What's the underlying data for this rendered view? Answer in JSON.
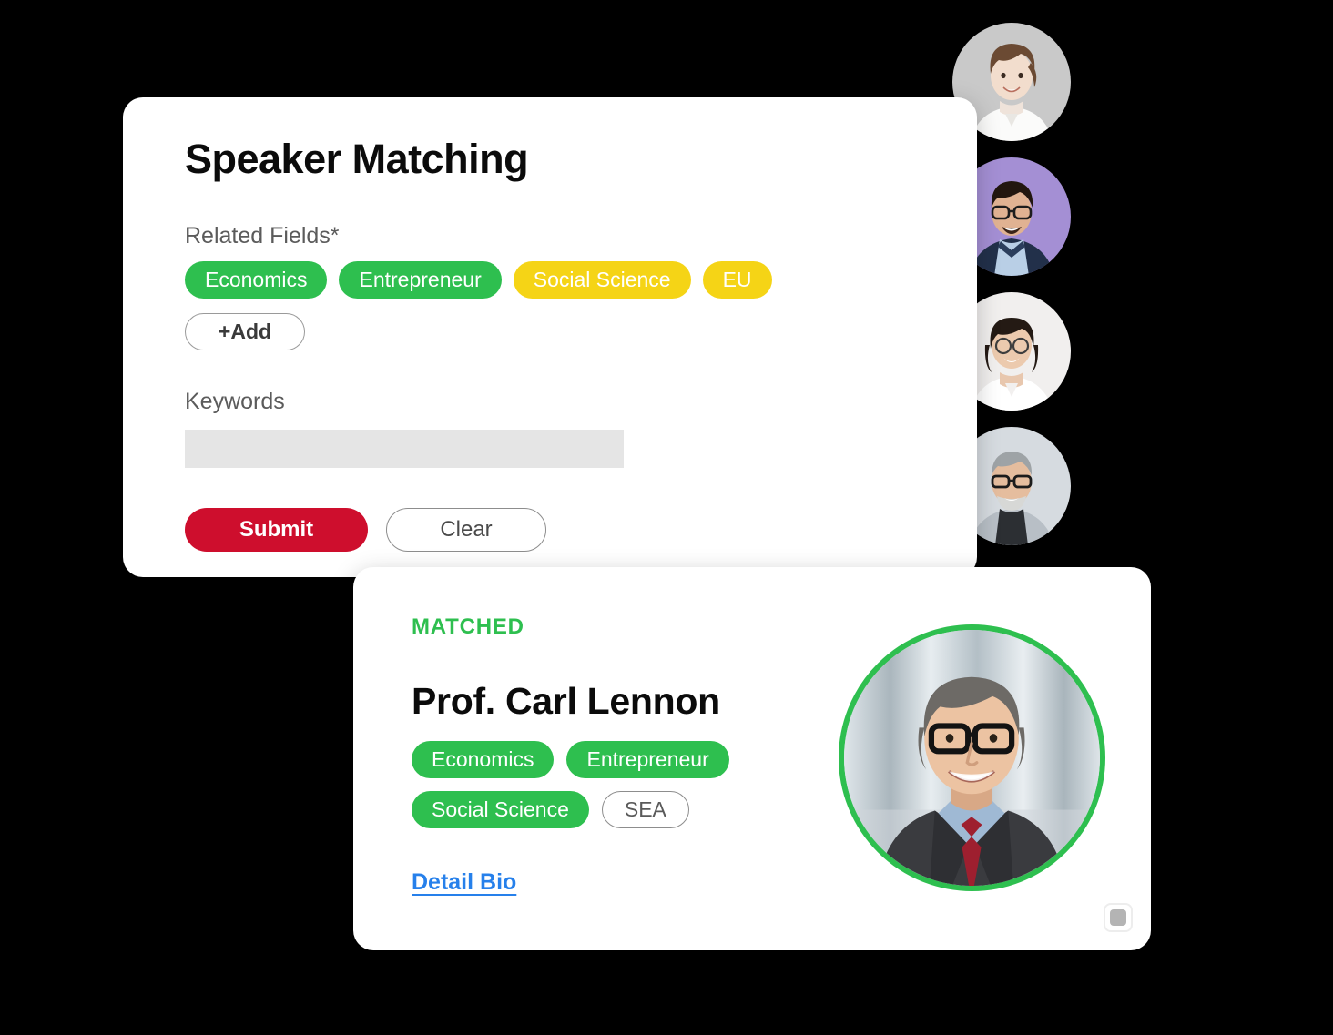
{
  "background_color": "#000000",
  "form_card": {
    "title": "Speaker Matching",
    "related_fields_label": "Related Fields*",
    "tags": [
      {
        "label": "Economics",
        "color": "#2ebf4f",
        "style": "green"
      },
      {
        "label": "Entrepreneur",
        "color": "#2ebf4f",
        "style": "green"
      },
      {
        "label": "Social Science",
        "color": "#f5d416",
        "style": "yellow"
      },
      {
        "label": "EU",
        "color": "#f5d416",
        "style": "yellow"
      }
    ],
    "add_button_label": "+Add",
    "keywords_label": "Keywords",
    "keywords_value": "",
    "keywords_placeholder": "",
    "submit_label": "Submit",
    "submit_color": "#ce0e2d",
    "clear_label": "Clear"
  },
  "matched_card": {
    "badge": "MATCHED",
    "badge_color": "#2ebf4f",
    "speaker_name": "Prof. Carl Lennon",
    "tags": [
      {
        "label": "Economics",
        "style": "green"
      },
      {
        "label": "Entrepreneur",
        "style": "green"
      },
      {
        "label": "Social Science",
        "style": "green"
      },
      {
        "label": "SEA",
        "style": "outline"
      }
    ],
    "detail_link_label": "Detail Bio",
    "detail_link_color": "#2680eb",
    "portrait_alt": "speaker-portrait-photo",
    "portrait_ring_color": "#2ebf4f",
    "corner_handle_icon": "stop-square-icon"
  },
  "avatar_rail": {
    "avatars": [
      {
        "name": "avatar-candidate-1",
        "background": "#c9c9c9"
      },
      {
        "name": "avatar-candidate-2",
        "background": "#a48fd4"
      },
      {
        "name": "avatar-candidate-3",
        "background": "#f1efee"
      },
      {
        "name": "avatar-candidate-4",
        "background": "#d6dbe0"
      }
    ]
  }
}
